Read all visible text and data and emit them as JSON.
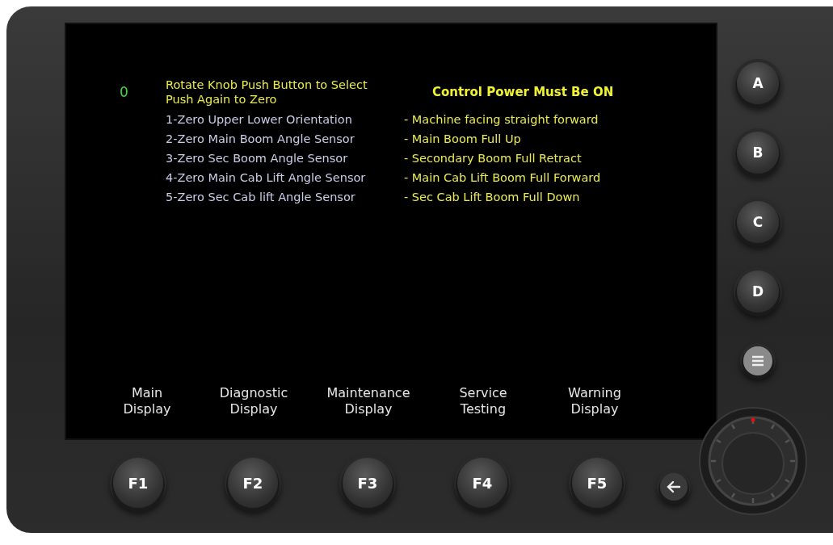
{
  "screen": {
    "status_value": "0",
    "instructions": [
      "Rotate Knob Push Button to Select",
      "Push Again to Zero"
    ],
    "warning": "Control Power Must Be ON",
    "steps": [
      {
        "label": "1-Zero Upper Lower Orientation",
        "position": "- Machine facing straight forward"
      },
      {
        "label": "2-Zero Main Boom Angle Sensor",
        "position": "- Main Boom Full Up"
      },
      {
        "label": "3-Zero Sec Boom Angle Sensor",
        "position": "- Secondary Boom Full Retract"
      },
      {
        "label": "4-Zero Main Cab Lift Angle Sensor",
        "position": "- Main Cab Lift Boom Full Forward"
      },
      {
        "label": "5-Zero Sec Cab lift Angle Sensor",
        "position": "- Sec Cab Lift Boom Full Down"
      }
    ],
    "soft_keys": [
      {
        "lines": [
          "Main",
          "Display"
        ]
      },
      {
        "lines": [
          "Diagnostic",
          "Display"
        ]
      },
      {
        "lines": [
          "Maintenance",
          "Display"
        ]
      },
      {
        "lines": [
          "Service",
          "Testing"
        ]
      },
      {
        "lines": [
          "Warning",
          "Display"
        ]
      }
    ]
  },
  "function_keys": [
    "F1",
    "F2",
    "F3",
    "F4",
    "F5"
  ],
  "side_keys": [
    "A",
    "B",
    "C",
    "D"
  ]
}
